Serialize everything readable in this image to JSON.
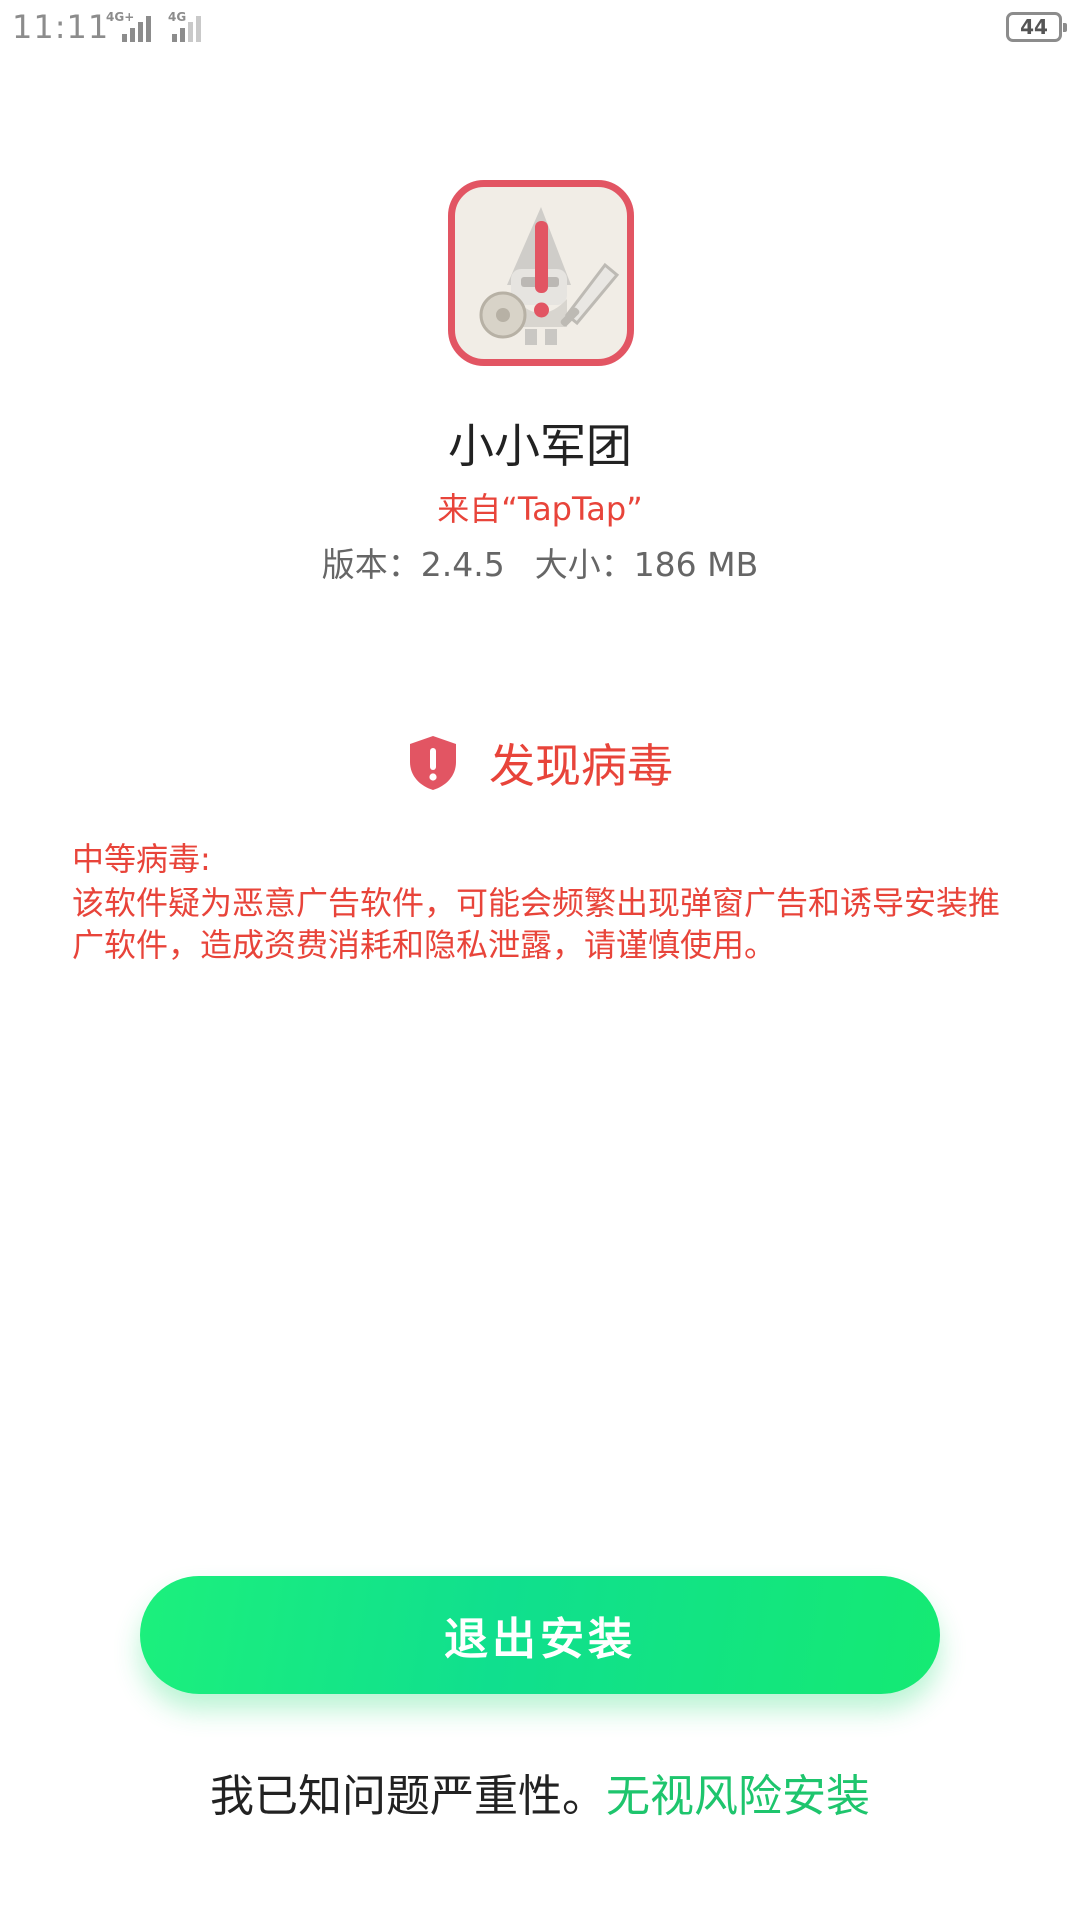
{
  "status_bar": {
    "time": "11:11",
    "sim1_network": "4G+",
    "sim2_network": "4G",
    "battery": "44"
  },
  "app": {
    "icon": "warrior-game-icon-with-warning",
    "name": "小小军团",
    "source": "来自“TapTap”",
    "version": "版本：2.4.5",
    "size": "大小：186 MB"
  },
  "warning": {
    "icon": "shield-alert-icon",
    "title": "发现病毒",
    "level": "中等病毒:",
    "description": "该软件疑为恶意广告软件，可能会频繁出现弹窗广告和诱导安装推广软件，造成资费消耗和隐私泄露，请谨慎使用。"
  },
  "actions": {
    "exit_label": "退出安装",
    "ignore_prefix": "我已知问题严重性。",
    "ignore_link": "无视风险安装"
  },
  "colors": {
    "danger": "#e8443a",
    "accent_green": "#1ec56d",
    "icon_border": "#e25563"
  }
}
